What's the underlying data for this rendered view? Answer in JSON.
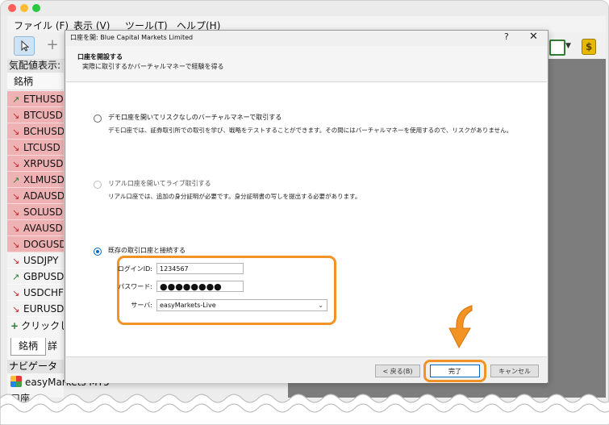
{
  "menu": {
    "items": [
      "ファイル (F)",
      "表示 (V)",
      "ツール(T)",
      "ヘルプ(H)"
    ]
  },
  "market_watch": {
    "header": "気配値表示:",
    "column": "銘柄",
    "symbols": [
      {
        "name": "ETHUSD",
        "dir": "up",
        "bg": "down"
      },
      {
        "name": "BTCUSD",
        "dir": "down",
        "bg": "down"
      },
      {
        "name": "BCHUSD",
        "dir": "down",
        "bg": "down"
      },
      {
        "name": "LTCUSD",
        "dir": "down",
        "bg": "down"
      },
      {
        "name": "XRPUSD",
        "dir": "down",
        "bg": "down"
      },
      {
        "name": "XLMUSD",
        "dir": "up",
        "bg": "down"
      },
      {
        "name": "ADAUSD",
        "dir": "down",
        "bg": "down"
      },
      {
        "name": "SOLUSD",
        "dir": "down",
        "bg": "down"
      },
      {
        "name": "AVAUSD",
        "dir": "down",
        "bg": "down"
      },
      {
        "name": "DOGUSD",
        "dir": "down",
        "bg": "down"
      },
      {
        "name": "USDJPY",
        "dir": "down",
        "bg": "neutral"
      },
      {
        "name": "GBPUSD",
        "dir": "up",
        "bg": "neutral"
      },
      {
        "name": "USDCHF",
        "dir": "down",
        "bg": "neutral"
      },
      {
        "name": "EURUSD",
        "dir": "down",
        "bg": "neutral"
      }
    ],
    "add_row": "クリックして",
    "tabs": [
      "銘柄",
      "詳"
    ]
  },
  "navigator": {
    "header": "ナビゲータ",
    "item": "easyMarkets MT5",
    "item2": "口座"
  },
  "dialog": {
    "title": "口座を開: Blue Capital Markets Limited",
    "help": "?",
    "close": "✕",
    "header_title": "口座を開設する",
    "header_sub": "実際に取引するかバーチャルマネーで経験を得る",
    "options": [
      {
        "title": "デモ口座を開いてリスクなしのバーチャルマネーで取引する",
        "desc": "デモ口座では、証券取引所での取引を学び、戦略をテストすることができます。その間にはバーチャルマネーを使用するので、リスクがありません。"
      },
      {
        "title": "リアル口座を開いてライブ取引する",
        "desc": "リアル口座では、追加の身分証明が必要です。身分証明書の写しを提出する必要があります。"
      },
      {
        "title": "既存の取引口座と接続する",
        "desc": ""
      }
    ],
    "login": {
      "login_label": "ログインID:",
      "login_value": "1234567",
      "password_label": "パスワード:",
      "password_value": "●●●●●●●●",
      "server_label": "サーバ:",
      "server_value": "easyMarkets-Live"
    },
    "buttons": {
      "back": "< 戻る(B)",
      "finish": "完了",
      "cancel": "キャンセル"
    }
  },
  "colors": {
    "highlight": "#f39323",
    "accent": "#0067c0",
    "down_row": "#efb2b4"
  }
}
